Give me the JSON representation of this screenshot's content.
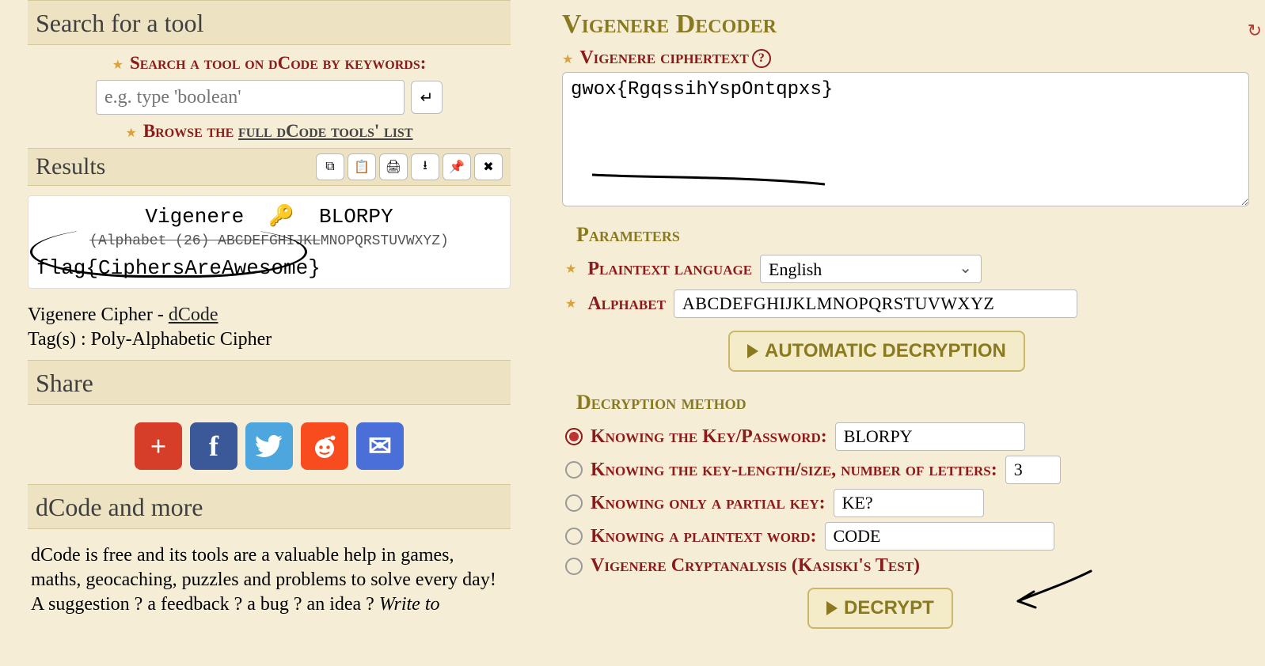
{
  "left": {
    "search_header": "Search for a tool",
    "search_label": "Search a tool on dCode by keywords:",
    "search_placeholder": "e.g. type 'boolean'",
    "browse_prefix": "Browse the ",
    "browse_link": "full dCode tools' list",
    "results_header": "Results",
    "result_cipher": "Vigenere",
    "result_key_icon": "🔑",
    "result_key": "BLORPY",
    "alphabet_prefix": "(Alphabet (26) ABCDEFGHIJKL",
    "alphabet_suffix": "MNOPQRSTUVWXYZ)",
    "flag": "flag{CiphersAreAwesome}",
    "cipher_line_prefix": "Vigenere Cipher - ",
    "cipher_link": "dCode",
    "tags_line": "Tag(s) : Poly-Alphabetic Cipher",
    "share_header": "Share",
    "about_header": "dCode and more",
    "about_p1": "dCode is free and its tools are a valuable help in games, maths, geocaching, puzzles and problems to solve every day!",
    "about_p2_prefix": "A suggestion ? a feedback ? a bug ? an idea ? ",
    "about_p2_italic": "Write to"
  },
  "right": {
    "title": "Vigenere Decoder",
    "ciphertext_label": "Vigenere ciphertext",
    "ciphertext_value": "gwox{RgqssihYspOntqpxs}",
    "params_header": "Parameters",
    "lang_label": "Plaintext language",
    "lang_value": "English",
    "alphabet_label": "Alphabet",
    "alphabet_value": "ABCDEFGHIJKLMNOPQRSTUVWXYZ",
    "auto_btn": "AUTOMATIC DECRYPTION",
    "method_header": "Decryption method",
    "opt_key_label": "Knowing the Key/Password:",
    "opt_key_value": "BLORPY",
    "opt_len_label": "Knowing the key-length/size, number of letters:",
    "opt_len_value": "3",
    "opt_partial_label": "Knowing only a partial key:",
    "opt_partial_value": "KE?",
    "opt_word_label": "Knowing a plaintext word:",
    "opt_word_value": "CODE",
    "opt_kasiski_label": "Vigenere Cryptanalysis (Kasiski's Test)",
    "decrypt_btn": "DECRYPT"
  }
}
